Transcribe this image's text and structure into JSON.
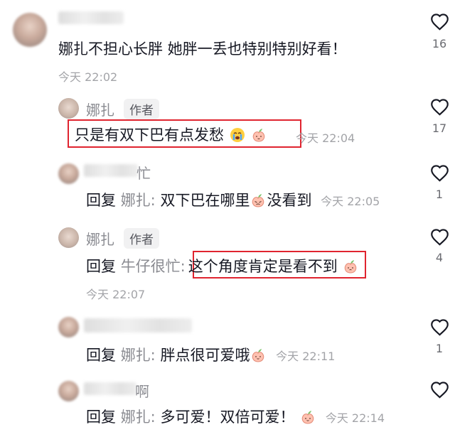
{
  "comments": [
    {
      "text": "娜扎不担心长胖  她胖一丢也特别特别好看！",
      "time": "今天 22:02",
      "likes": "16"
    },
    {
      "author": "娜扎",
      "badge": "作者",
      "text": "只是有双下巴有点发愁",
      "time": "今天 22:04",
      "likes": "17"
    },
    {
      "name_partial": "忙",
      "reply_label": "回复",
      "reply_to": "娜扎:",
      "text_a": "双下巴在哪里",
      "text_b": "没看到",
      "time": "今天 22:05",
      "likes": "1"
    },
    {
      "author": "娜扎",
      "badge": "作者",
      "reply_label": "回复",
      "reply_to": "牛仔很忙:",
      "text": "这个角度肯定是看不到",
      "time": "今天 22:07",
      "likes": "4"
    },
    {
      "reply_label": "回复",
      "reply_to": "娜扎:",
      "text": "胖点很可爱哦",
      "time": "今天 22:11",
      "likes": "1"
    },
    {
      "name_partial": "啊",
      "reply_label": "回复",
      "reply_to": "娜扎:",
      "text": "多可爱！双倍可爱！",
      "time": "今天 22:14"
    }
  ],
  "icons": {
    "like": "heart-outline-icon",
    "emoji_peach": "peach-emoji-icon",
    "emoji_crying": "crying-face-icon"
  },
  "colors": {
    "highlight_box": "#e0242f",
    "secondary_text": "#8a8b91"
  }
}
